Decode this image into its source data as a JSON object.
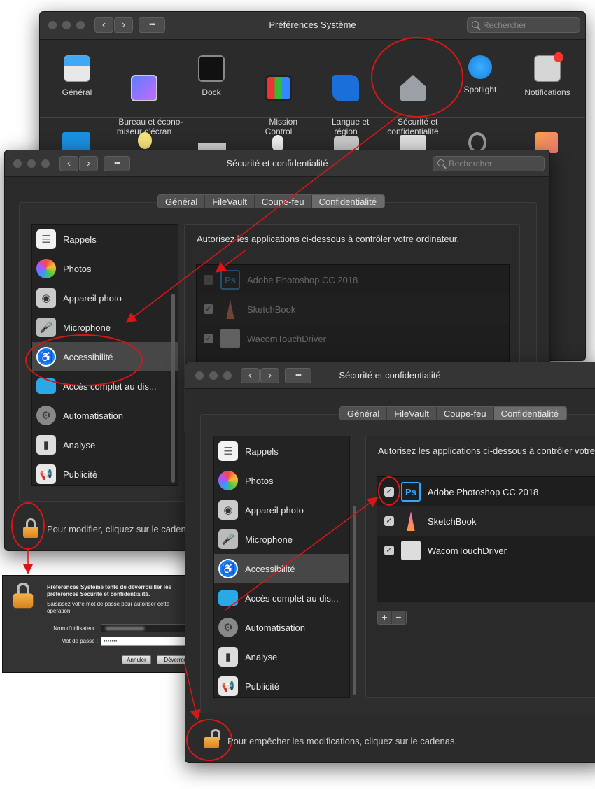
{
  "colors": {
    "annotation": "#d81616",
    "accent_blue": "#0a84ff",
    "lock_orange": "#f0a030"
  },
  "window1": {
    "title": "Préférences Système",
    "search_placeholder": "Rechercher",
    "prefs": [
      {
        "label": "Général",
        "icon": "general-icon"
      },
      {
        "label": "Bureau et écono-\nmiseur d'écran",
        "icon": "desktop-icon"
      },
      {
        "label": "Dock",
        "icon": "dock-icon"
      },
      {
        "label": "Mission\nControl",
        "icon": "mission-control-icon"
      },
      {
        "label": "Langue et\nrégion",
        "icon": "globe-flag-icon"
      },
      {
        "label": "Sécurité et\nconfidentialité",
        "icon": "security-house-icon"
      },
      {
        "label": "Spotlight",
        "icon": "spotlight-icon"
      },
      {
        "label": "Notifications",
        "icon": "notifications-icon"
      }
    ]
  },
  "window2": {
    "title": "Sécurité et confidentialité",
    "search_placeholder": "Rechercher",
    "tabs": [
      "Général",
      "FileVault",
      "Coupe-feu",
      "Confidentialité"
    ],
    "description": "Autorisez les applications ci-dessous à contrôler votre ordinateur.",
    "sidebar": [
      "Rappels",
      "Photos",
      "Appareil photo",
      "Microphone",
      "Accessibilité",
      "Accès complet au dis...",
      "Automatisation",
      "Analyse",
      "Publicité"
    ],
    "apps": [
      {
        "name": "Adobe Photoshop CC 2018",
        "checked": false
      },
      {
        "name": "SketchBook",
        "checked": true
      },
      {
        "name": "WacomTouchDriver",
        "checked": true
      }
    ],
    "lock_text": "Pour modifier, cliquez sur le cadenas."
  },
  "auth_dialog": {
    "heading": "Préférences Système tente de déverrouiller les préférences Sécurité et confidentialité.",
    "subtext": "Saisissez votre mot de passe pour autoriser cette opération.",
    "username_label": "Nom d'utilisateur :",
    "password_label": "Mot de passe :",
    "password_value": "•••••••",
    "cancel": "Annuler",
    "unlock": "Déverrouiller"
  },
  "window3": {
    "title": "Sécurité et confidentialité",
    "tabs": [
      "Général",
      "FileVault",
      "Coupe-feu",
      "Confidentialité"
    ],
    "description": "Autorisez les applications ci-dessous à contrôler votre ordinateur.",
    "sidebar": [
      "Rappels",
      "Photos",
      "Appareil photo",
      "Microphone",
      "Accessibilité",
      "Accès complet au dis...",
      "Automatisation",
      "Analyse",
      "Publicité"
    ],
    "apps": [
      {
        "name": "Adobe Photoshop CC 2018",
        "checked": true
      },
      {
        "name": "SketchBook",
        "checked": true
      },
      {
        "name": "WacomTouchDriver",
        "checked": true
      }
    ],
    "lock_text": "Pour empêcher les modifications, cliquez sur le cadenas."
  }
}
